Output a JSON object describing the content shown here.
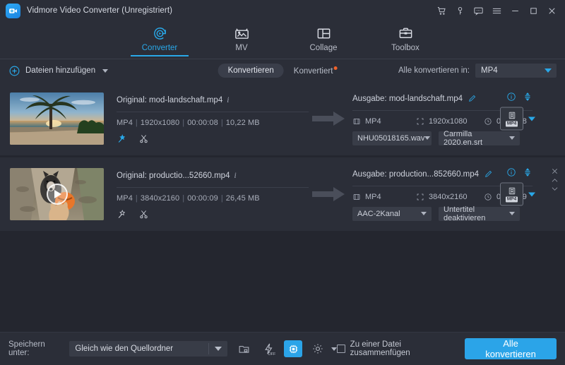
{
  "window": {
    "title": "Vidmore Video Converter (Unregistriert)",
    "logo_icon": "video-camera-icon",
    "controls": [
      {
        "name": "cart-icon",
        "glyph": "cart"
      },
      {
        "name": "key-icon",
        "glyph": "key"
      },
      {
        "name": "feedback-icon",
        "glyph": "chat"
      },
      {
        "name": "menu-icon",
        "glyph": "hamburger"
      },
      {
        "name": "minimize-icon",
        "glyph": "minimize"
      },
      {
        "name": "maximize-icon",
        "glyph": "maximize"
      },
      {
        "name": "close-icon",
        "glyph": "close"
      }
    ]
  },
  "nav": {
    "tabs": [
      {
        "label": "Converter",
        "icon": "converter-icon",
        "active": true
      },
      {
        "label": "MV",
        "icon": "mv-icon",
        "active": false
      },
      {
        "label": "Collage",
        "icon": "collage-icon",
        "active": false
      },
      {
        "label": "Toolbox",
        "icon": "toolbox-icon",
        "active": false
      }
    ]
  },
  "actionbar": {
    "add_files_label": "Dateien hinzufügen",
    "add_files_icon": "plus-circle-icon",
    "segment_converting": "Konvertieren",
    "segment_converted": "Konvertiert",
    "convert_all_label": "Alle konvertieren in:",
    "convert_all_value": "MP4"
  },
  "files": [
    {
      "thumbnail": "beach-sunset-palm-tree",
      "source_prefix": "Original:",
      "source_name": "mod-landschaft.mp4",
      "source_format": "MP4",
      "source_resolution": "1920x1080",
      "source_duration": "00:00:08",
      "source_size": "10,22 MB",
      "enhance_icon": "magic-wand-icon",
      "enhance_active": true,
      "trim_icon": "scissors-icon",
      "output_prefix": "Ausgabe:",
      "output_name": "mod-landschaft.mp4",
      "edit_icon": "pencil-icon",
      "info_icon": "info-icon",
      "updown_icon": "arrows-updown-icon",
      "out_format": "MP4",
      "out_resolution": "1920x1080",
      "out_duration": "00:00:08",
      "audio_track": "NHU05018165.wav",
      "subtitle_track": "Carmilla 2020.en.srt",
      "format_badge": "MP4",
      "has_row_controls": false
    },
    {
      "thumbnail": "husky-dog-ball",
      "source_prefix": "Original:",
      "source_name": "productio...52660.mp4",
      "source_format": "MP4",
      "source_resolution": "3840x2160",
      "source_duration": "00:00:09",
      "source_size": "26,45 MB",
      "enhance_icon": "magic-wand-icon",
      "enhance_active": false,
      "trim_icon": "scissors-icon",
      "output_prefix": "Ausgabe:",
      "output_name": "production...852660.mp4",
      "edit_icon": "pencil-icon",
      "info_icon": "info-icon",
      "updown_icon": "arrows-updown-icon",
      "out_format": "MP4",
      "out_resolution": "3840x2160",
      "out_duration": "00:00:09",
      "audio_track": "AAC-2Kanal",
      "subtitle_track": "Untertitel deaktivieren",
      "format_badge": "MP4",
      "has_row_controls": true,
      "row_controls": [
        "remove-icon",
        "move-up-icon",
        "move-down-icon"
      ]
    }
  ],
  "bottombar": {
    "save_label": "Speichern unter:",
    "save_value": "Gleich wie den Quellordner",
    "folder_icon": "folder-icon",
    "speed_icon": "lightning-off-icon",
    "gpu_icon": "gpu-acceleration-icon",
    "gear_icon": "settings-gear-icon",
    "merge_label": "Zu einer Datei zusammenfügen",
    "merge_checked": false,
    "convert_all_button": "Alle konvertieren"
  },
  "colors": {
    "accent": "#29a8e8",
    "page_bg": "#24262f",
    "panel_bg": "#2b2e38",
    "badge_orange": "#f0622b"
  }
}
